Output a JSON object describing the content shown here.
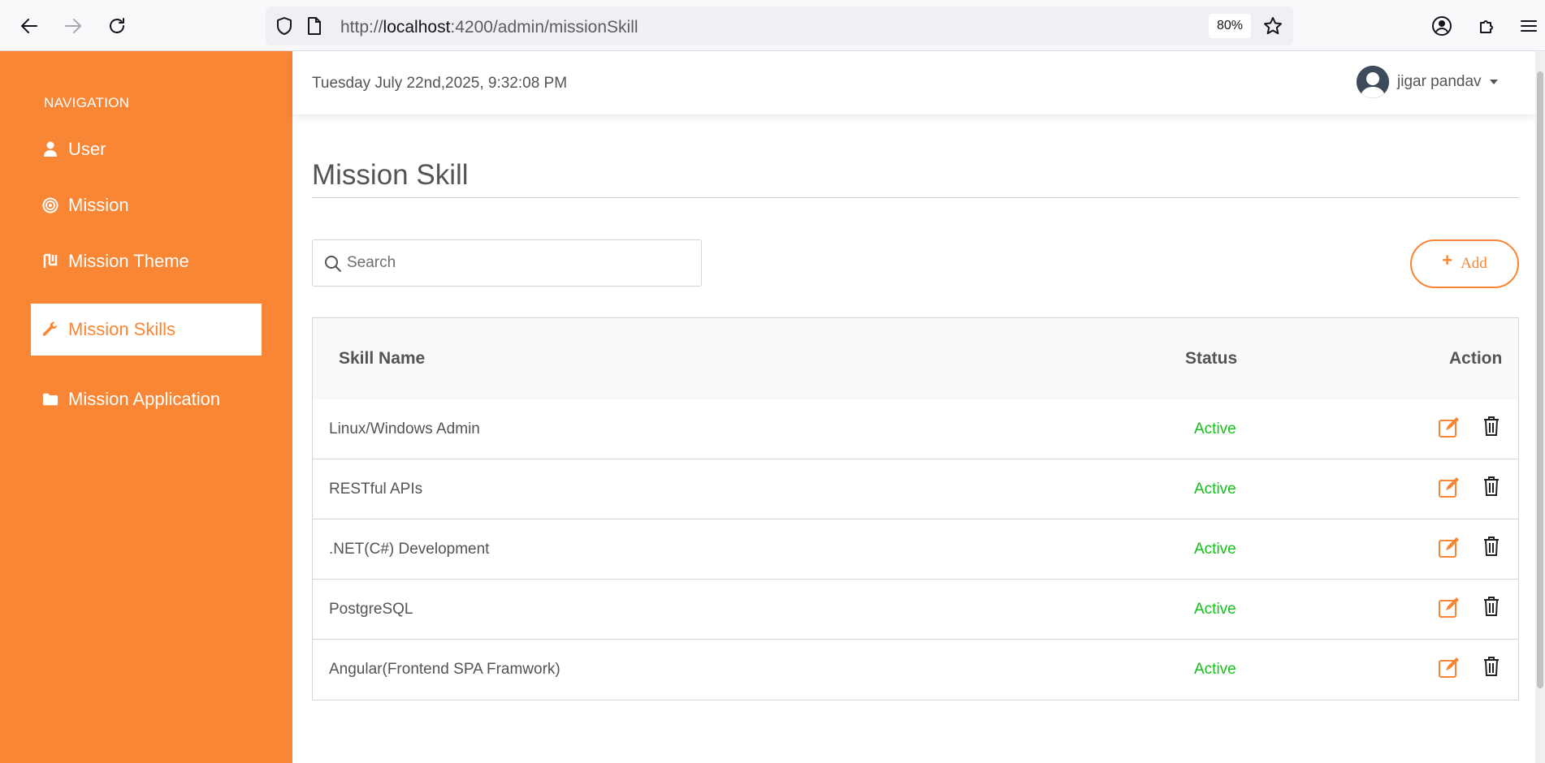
{
  "browser": {
    "url_scheme": "http://",
    "url_host": "localhost",
    "url_path": ":4200/admin/missionSkill",
    "zoom": "80%"
  },
  "sidebar": {
    "heading": "NAVIGATION",
    "items": [
      {
        "label": "User",
        "icon": "user-icon"
      },
      {
        "label": "Mission",
        "icon": "target-icon"
      },
      {
        "label": "Mission Theme",
        "icon": "theme-icon"
      },
      {
        "label": "Mission Skills",
        "icon": "wrench-icon",
        "active": true
      },
      {
        "label": "Mission Application",
        "icon": "folder-icon"
      }
    ]
  },
  "header": {
    "datetime": "Tuesday July 22nd,2025, 9:32:08 PM",
    "username": "jigar pandav"
  },
  "main": {
    "title": "Mission Skill",
    "search_placeholder": "Search",
    "add_label": "Add"
  },
  "table": {
    "columns": [
      "Skill Name",
      "Status",
      "Action"
    ],
    "rows": [
      {
        "name": "Linux/Windows Admin",
        "status": "Active"
      },
      {
        "name": "RESTful APIs",
        "status": "Active"
      },
      {
        "name": ".NET(C#) Development",
        "status": "Active"
      },
      {
        "name": "PostgreSQL",
        "status": "Active"
      },
      {
        "name": "Angular(Frontend SPA Framwork)",
        "status": "Active"
      }
    ]
  },
  "colors": {
    "brand": "#f88634",
    "active_status": "#14c01a",
    "text": "#545454"
  }
}
